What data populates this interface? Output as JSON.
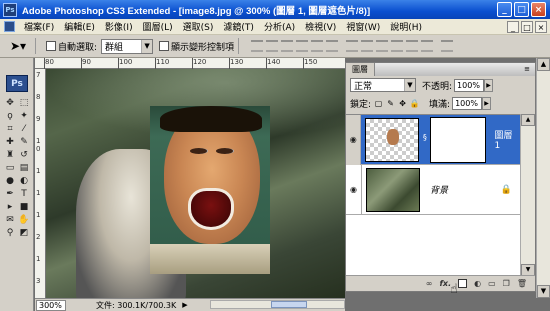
{
  "window": {
    "title": "Adobe Photoshop CS3 Extended - [image8.jpg @ 300% (圖層 1, 圖層遮色片/8)]",
    "app_icon_text": "Ps",
    "controls": [
      "_",
      "□",
      "×"
    ]
  },
  "menubar": {
    "items": [
      "檔案(F)",
      "編輯(E)",
      "影像(I)",
      "圖層(L)",
      "選取(S)",
      "濾鏡(T)",
      "分析(A)",
      "檢視(V)",
      "視窗(W)",
      "說明(H)"
    ],
    "doc_controls": [
      "_",
      "□",
      "×"
    ]
  },
  "options": {
    "auto_select_label": "自動選取:",
    "auto_select_value": "群組",
    "transform_label": "顯示變形控制項"
  },
  "tools": {
    "logo": "Ps"
  },
  "ruler": {
    "top_ticks": [
      "80",
      "90",
      "100",
      "110",
      "120",
      "130",
      "140",
      "150"
    ],
    "left_ticks": [
      "7",
      "8",
      "9",
      "1",
      "0",
      "1",
      "1",
      "1",
      "2",
      "1",
      "3"
    ]
  },
  "status": {
    "zoom": "300%",
    "doc_info": "文件: 300.1K/700.3K"
  },
  "layers_panel": {
    "tab": "圖層",
    "blend_mode": "正常",
    "opacity_label": "不透明:",
    "opacity_value": "100%",
    "lock_label": "鎖定:",
    "fill_label": "填滿:",
    "fill_value": "100%",
    "layers": [
      {
        "name": "圖層 1",
        "selected": true
      },
      {
        "name": "背景",
        "selected": false
      }
    ],
    "footer_icons": [
      "link-icon",
      "fx-icon",
      "add-mask-icon",
      "adjustment-icon",
      "folder-icon",
      "new-layer-icon",
      "trash-icon"
    ]
  },
  "colors": {
    "titlebar": "#0a4fcf",
    "selection": "#3169c6",
    "panel": "#d4d0c8"
  }
}
